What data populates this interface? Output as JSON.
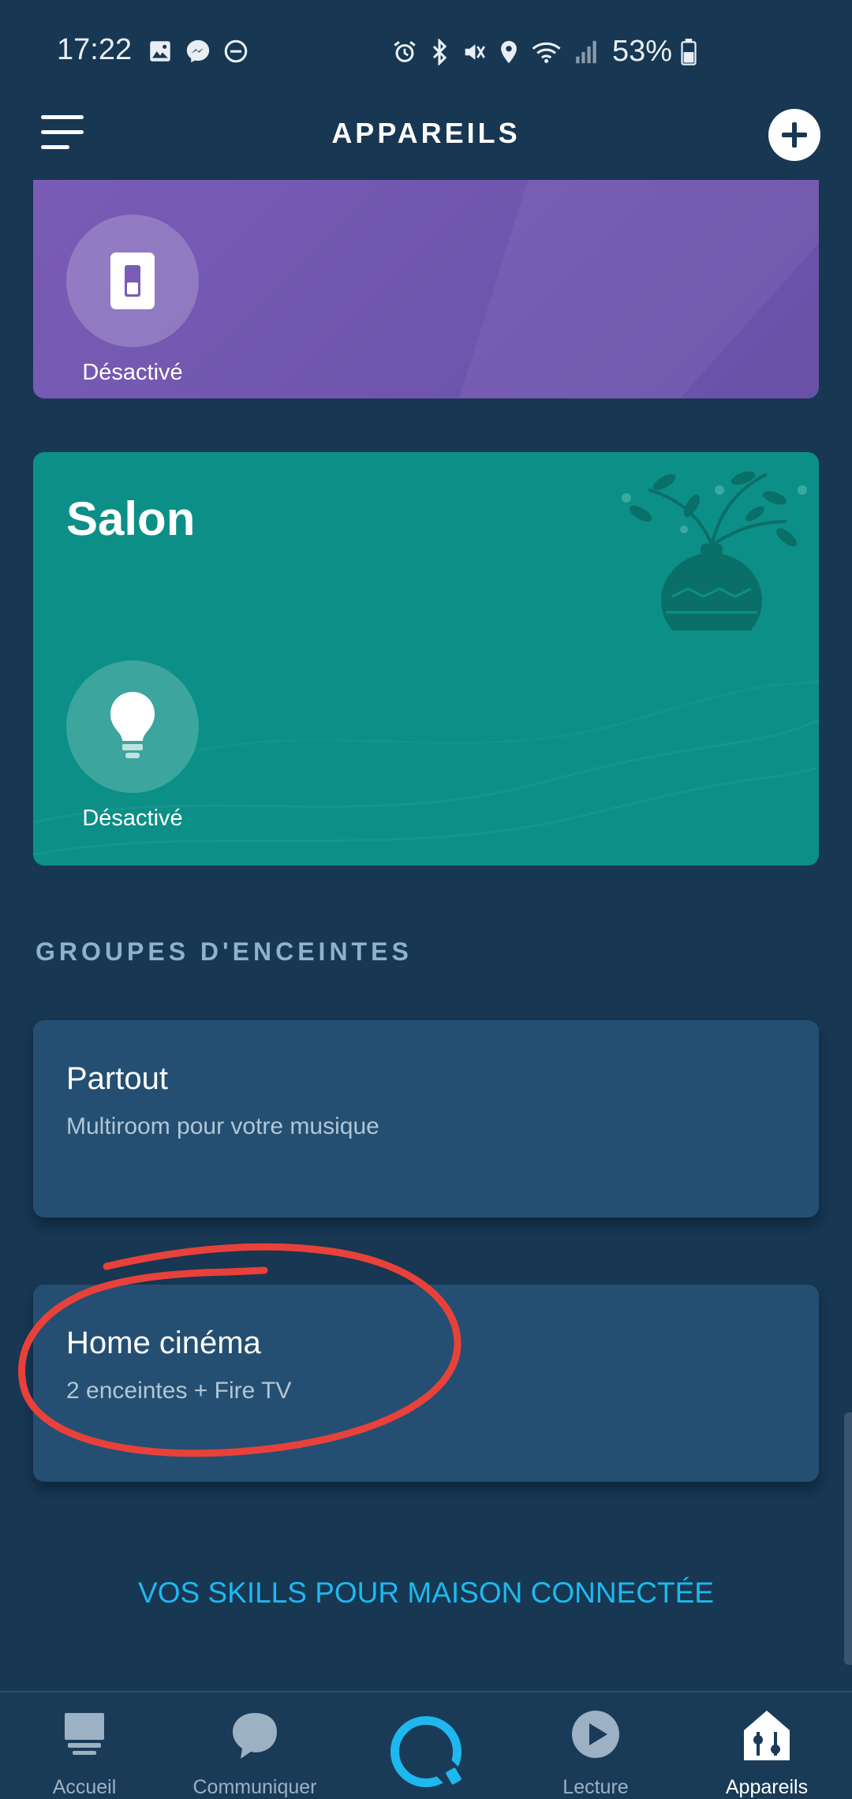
{
  "status_bar": {
    "time": "17:22",
    "battery_percent": "53%",
    "left_icons": [
      "gallery-icon",
      "messenger-icon",
      "do-not-disturb-icon"
    ],
    "right_icons": [
      "alarm-icon",
      "bluetooth-icon",
      "mute-icon",
      "location-icon",
      "wifi-icon",
      "signal-icon",
      "battery-icon"
    ]
  },
  "header": {
    "title": "APPAREILS",
    "menu_icon": "hamburger-menu-icon",
    "add_icon": "plus-icon"
  },
  "rooms": [
    {
      "name": "",
      "color": "#7259b0",
      "device": {
        "icon": "light-switch-icon",
        "status": "Désactivé"
      }
    },
    {
      "name": "Salon",
      "color": "#0c8f86",
      "device": {
        "icon": "light-bulb-icon",
        "status": "Désactivé"
      }
    }
  ],
  "speaker_groups": {
    "title": "GROUPES D'ENCEINTES",
    "items": [
      {
        "name": "Partout",
        "description": "Multiroom pour votre musique"
      },
      {
        "name": "Home cinéma",
        "description": "2 enceintes  + Fire TV"
      }
    ]
  },
  "skills_link": "VOS SKILLS POUR MAISON CONNECTÉE",
  "annotation": {
    "type": "red-hand-drawn-circle",
    "color": "#e8413a"
  },
  "bottom_nav": {
    "items": [
      {
        "label": "Accueil",
        "icon": "home-feed-icon",
        "active": false
      },
      {
        "label": "Communiquer",
        "icon": "chat-bubble-icon",
        "active": false
      },
      {
        "label": "",
        "icon": "alexa-ring-icon",
        "active": false
      },
      {
        "label": "Lecture",
        "icon": "play-icon",
        "active": false
      },
      {
        "label": "Appareils",
        "icon": "smart-home-icon",
        "active": true
      }
    ],
    "accent_color": "#1eb8ef"
  }
}
